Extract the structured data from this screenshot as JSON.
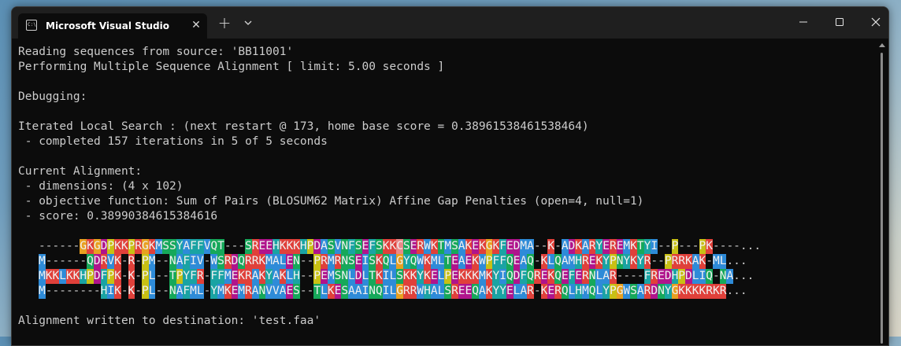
{
  "window": {
    "tab_title": "Microsoft Visual Studio Debug Console",
    "tab_icon": "console-icon",
    "close_tab_glyph": "✕",
    "new_tab_glyph": "+",
    "colors": {
      "titlebar": "#1f1f1f",
      "console_bg": "#0c0c0c",
      "text": "#cccccc"
    }
  },
  "console": {
    "lines": [
      "Reading sequences from source: 'BB11001'",
      "Performing Multiple Sequence Alignment [ limit: 5.00 seconds ]",
      "",
      "Debugging:",
      "",
      "Iterated Local Search : (next restart @ 173, home base score = 0.38961538461538464)",
      " - completed 157 iterations in 5 of 5 seconds",
      "",
      "Current Alignment:",
      " - dimensions: (4 x 102)",
      " - objective function: Sum of Pairs (BLOSUM62 Matrix) Affine Gap Penalties (open=4, null=1)",
      " - score: 0.38990384615384616"
    ],
    "sequences": [
      "------GKGDPKKPRGKMSSYAFFVQT---SREEHKKKHPDASVNFSEFSKKCSERWKTMSAKEKGKFEDMA--K-ADKARYEREMKTYI--P---PK----...",
      "M------QDRVK-R-PM--NAFIV-WSRDQRRKMALEN--PRMRNSEISKQLGYQWKMLTEAEKWPFFQEAQ-KLQAMHREKYPNYKYR--PRRKAK-ML...",
      "MKKLKKHPDFPK-K-PL--TPYFR-FFMEKRAKYAKLH--PEMSNLDLTKILSKKYKELPEKKKMKYIQDFQREKQEFERNLAR----FREDHPDLIQ-NA...",
      "M--------HIK-K-PL--NAFML-YMKEMRANVVAES--TLKESAAINQILGRRWHALSREEQAKYYELAR-KERQLHMQLYPGWSARDNYGKKKKRKR..."
    ],
    "footer": "Alignment written to destination: 'test.faa'"
  },
  "residue_colors": {
    "hydrophobic": "#2e8bd8",
    "positive": "#e0403a",
    "negative": "#b0148c",
    "polar": "#16a85a",
    "cysteine": "#e88a8a",
    "glycine": "#e8a020",
    "proline": "#c8c014",
    "aromatic": "#1aa3a3"
  }
}
